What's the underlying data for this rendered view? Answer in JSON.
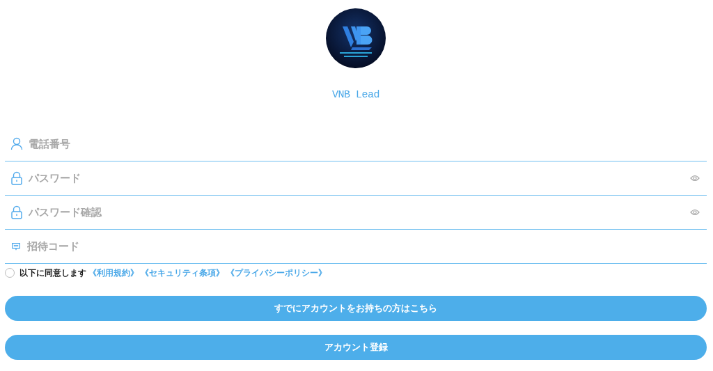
{
  "app": {
    "name": "VNB Lead"
  },
  "fields": [
    {
      "kind": "user",
      "placeholder": "電話番号",
      "reveal": false
    },
    {
      "kind": "lock",
      "placeholder": "パスワード",
      "reveal": true
    },
    {
      "kind": "lock",
      "placeholder": "パスワード確認",
      "reveal": true
    },
    {
      "kind": "message",
      "placeholder": "招待コード",
      "reveal": false
    }
  ],
  "agreement": {
    "checked": false,
    "text": "以下に同意します",
    "links": [
      "《利用規約》",
      "《セキュリティ条項》",
      "《プライバシーポリシー》"
    ]
  },
  "buttons": [
    "すでにアカウントをお持ちの方はこちら",
    "アカウント登録"
  ]
}
